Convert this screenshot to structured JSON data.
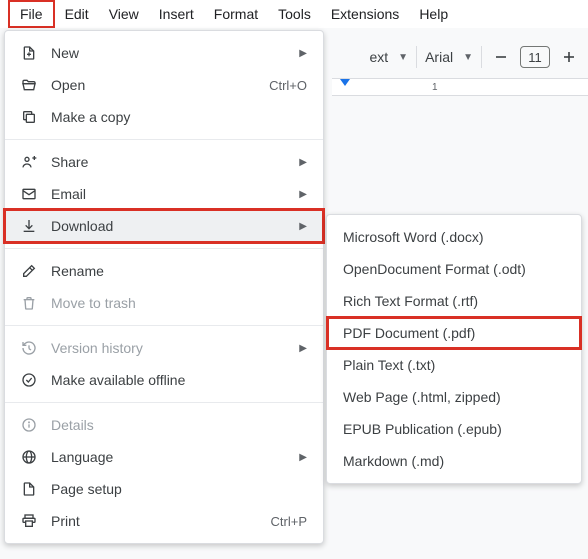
{
  "menubar": {
    "items": [
      "File",
      "Edit",
      "View",
      "Insert",
      "Format",
      "Tools",
      "Extensions",
      "Help"
    ],
    "active_index": 0
  },
  "toolbar": {
    "style_label": "ext",
    "font_label": "Arial",
    "font_size": "11"
  },
  "ruler": {
    "numbers": [
      "1"
    ]
  },
  "file_menu": {
    "new": "New",
    "open": "Open",
    "open_shortcut": "Ctrl+O",
    "make_copy": "Make a copy",
    "share": "Share",
    "email": "Email",
    "download": "Download",
    "rename": "Rename",
    "move_to_trash": "Move to trash",
    "version_history": "Version history",
    "offline": "Make available offline",
    "details": "Details",
    "language": "Language",
    "page_setup": "Page setup",
    "print": "Print",
    "print_shortcut": "Ctrl+P"
  },
  "download_menu": {
    "items": [
      "Microsoft Word (.docx)",
      "OpenDocument Format (.odt)",
      "Rich Text Format (.rtf)",
      "PDF Document (.pdf)",
      "Plain Text (.txt)",
      "Web Page (.html, zipped)",
      "EPUB Publication (.epub)",
      "Markdown (.md)"
    ],
    "highlight_index": 3
  },
  "callout_color": "#d93025"
}
